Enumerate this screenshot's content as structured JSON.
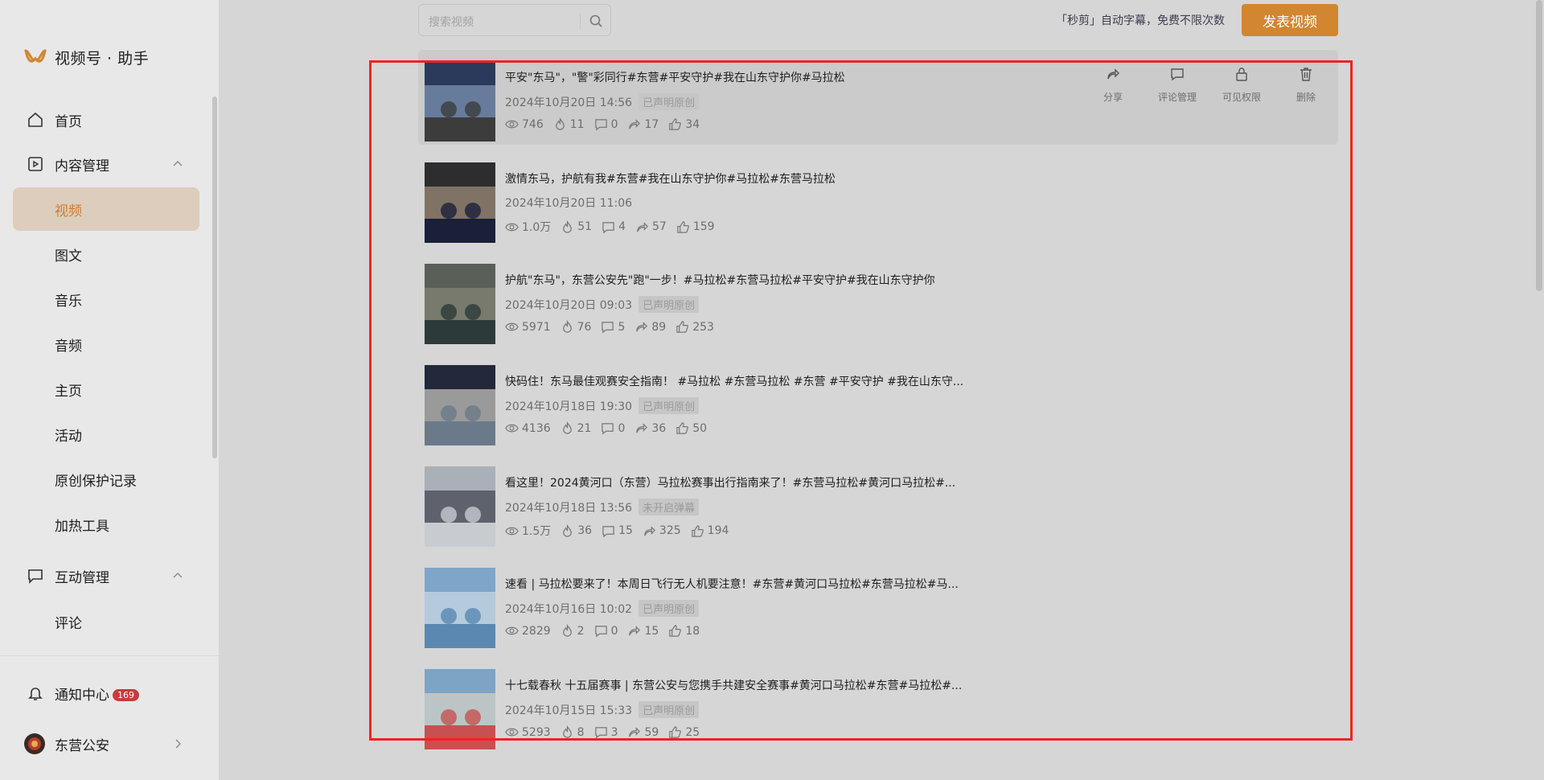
{
  "app": {
    "title": "视频号 · 助手"
  },
  "sidebar": {
    "items": [
      {
        "label": "首页"
      },
      {
        "label": "内容管理"
      },
      {
        "label": "视频"
      },
      {
        "label": "图文"
      },
      {
        "label": "音乐"
      },
      {
        "label": "音频"
      },
      {
        "label": "主页"
      },
      {
        "label": "活动"
      },
      {
        "label": "原创保护记录"
      },
      {
        "label": "加热工具"
      },
      {
        "label": "互动管理"
      },
      {
        "label": "评论"
      }
    ],
    "notify": {
      "label": "通知中心",
      "count": "169"
    },
    "account": {
      "name": "东营公安"
    }
  },
  "topbar": {
    "search_placeholder": "搜索视频",
    "promo": "「秒剪」自动字幕，免费不限次数",
    "publish_label": "发表视频"
  },
  "actions": [
    "分享",
    "评论管理",
    "可见权限",
    "删除"
  ],
  "videos": [
    {
      "title": "平安\"东马\"，\"警\"彩同行#东营#平安守护#我在山东守护你#马拉松",
      "date": "2024年10月20日 14:56",
      "tag": "已声明原创",
      "views": "746",
      "hot": "11",
      "comments": "0",
      "shares": "17",
      "likes": "34"
    },
    {
      "title": "激情东马，护航有我#东营#我在山东守护你#马拉松#东营马拉松",
      "date": "2024年10月20日 11:06",
      "tag": "",
      "views": "1.0万",
      "hot": "51",
      "comments": "4",
      "shares": "57",
      "likes": "159"
    },
    {
      "title": "护航\"东马\"，东营公安先\"跑\"一步！#马拉松#东营马拉松#平安守护#我在山东守护你",
      "date": "2024年10月20日 09:03",
      "tag": "已声明原创",
      "views": "5971",
      "hot": "76",
      "comments": "5",
      "shares": "89",
      "likes": "253"
    },
    {
      "title": "快码住！东马最佳观赛安全指南！ #马拉松 #东营马拉松 #东营 #平安守护 #我在山东守...",
      "date": "2024年10月18日 19:30",
      "tag": "已声明原创",
      "views": "4136",
      "hot": "21",
      "comments": "0",
      "shares": "36",
      "likes": "50"
    },
    {
      "title": "看这里！2024黄河口（东营）马拉松赛事出行指南来了！#东营马拉松#黄河口马拉松#...",
      "date": "2024年10月18日 13:56",
      "tag": "未开启弹幕",
      "views": "1.5万",
      "hot": "36",
      "comments": "15",
      "shares": "325",
      "likes": "194"
    },
    {
      "title": "速看 | 马拉松要来了！本周日飞行无人机要注意！#东营#黄河口马拉松#东营马拉松#马...",
      "date": "2024年10月16日 10:02",
      "tag": "已声明原创",
      "views": "2829",
      "hot": "2",
      "comments": "0",
      "shares": "15",
      "likes": "18"
    },
    {
      "title": "十七载春秋 十五届赛事 | 东营公安与您携手共建安全赛事#黄河口马拉松#东营#马拉松#...",
      "date": "2024年10月15日 15:33",
      "tag": "已声明原创",
      "views": "5293",
      "hot": "8",
      "comments": "3",
      "shares": "59",
      "likes": "25"
    }
  ]
}
